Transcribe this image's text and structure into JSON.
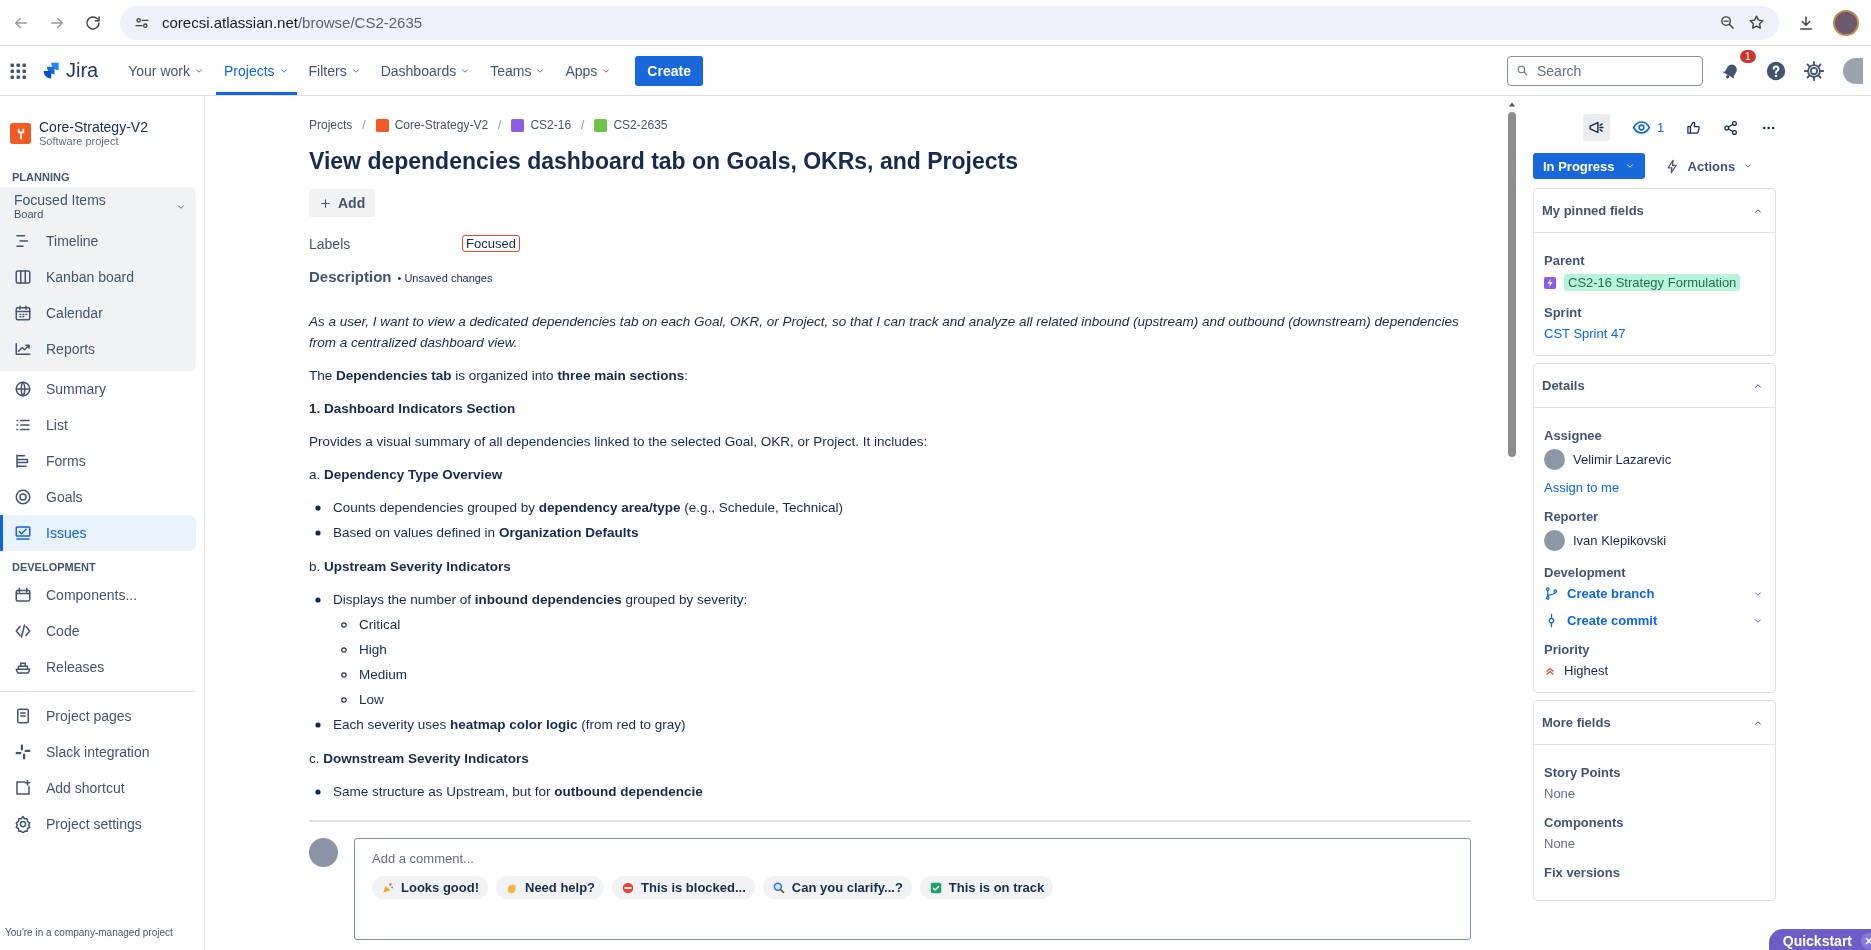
{
  "browser": {
    "url_host": "corecsi.atlassian.net",
    "url_path": "/browse/CS2-2635"
  },
  "nav": {
    "product": "Jira",
    "items": [
      {
        "label": "Your work",
        "selected": false
      },
      {
        "label": "Projects",
        "selected": true
      },
      {
        "label": "Filters",
        "selected": false
      },
      {
        "label": "Dashboards",
        "selected": false
      },
      {
        "label": "Teams",
        "selected": false
      },
      {
        "label": "Apps",
        "selected": false
      }
    ],
    "create": "Create",
    "search_placeholder": "Search",
    "notification_count": "1"
  },
  "sidebar": {
    "project": {
      "name": "Core-Strategy-V2",
      "type": "Software project"
    },
    "sections": [
      {
        "heading": "PLANNING",
        "group": {
          "title": "Focused Items",
          "subtitle": "Board",
          "expanded": true,
          "items": [
            {
              "label": "Timeline",
              "selected": false
            },
            {
              "label": "Kanban board",
              "selected": false
            },
            {
              "label": "Calendar",
              "selected": false
            },
            {
              "label": "Reports",
              "selected": false
            }
          ]
        },
        "items": [
          {
            "label": "Summary",
            "selected": false
          },
          {
            "label": "List",
            "selected": false
          },
          {
            "label": "Forms",
            "selected": false
          },
          {
            "label": "Goals",
            "selected": false
          },
          {
            "label": "Issues",
            "selected": true
          }
        ]
      },
      {
        "heading": "DEVELOPMENT",
        "items": [
          {
            "label": "Components...",
            "selected": false
          },
          {
            "label": "Code",
            "selected": false
          },
          {
            "label": "Releases",
            "selected": false
          }
        ]
      },
      {
        "items": [
          {
            "label": "Project pages",
            "selected": false
          },
          {
            "label": "Slack integration",
            "selected": false
          },
          {
            "label": "Add shortcut",
            "selected": false
          },
          {
            "label": "Project settings",
            "selected": false
          }
        ]
      }
    ],
    "footer": "You're in a company-managed project"
  },
  "issue": {
    "breadcrumbs": [
      "Projects",
      "Core-Strategy-V2",
      "CS2-16",
      "CS2-2635"
    ],
    "breadcrumb_separator": "/",
    "title": "View dependencies dashboard tab on Goals, OKRs, and Projects",
    "add_button": "Add",
    "labels": {
      "label": "Labels",
      "values": [
        "Focused"
      ]
    },
    "description": {
      "label": "Description",
      "note": "• Unsaved changes",
      "blocks": [
        {
          "kind": "intro",
          "text": "As a user, I want to view a dedicated dependencies tab on each Goal, OKR, or Project, so that I can track and analyze all related inbound (upstream) and outbound (downstream) dependencies from a centralized dashboard view."
        },
        {
          "kind": "paragraph",
          "text": "The **Dependencies tab** is organized into **three main sections**:"
        },
        {
          "kind": "heading",
          "text": "1. Dashboard Indicators Section"
        },
        {
          "kind": "paragraph",
          "text": "Provides a visual summary of all dependencies linked to the selected Goal, OKR, or Project. It includes:"
        },
        {
          "kind": "paragraph",
          "text": "a. **Dependency Type Overview**"
        },
        {
          "kind": "list",
          "items": [
            {
              "text": "Counts dependencies grouped by **dependency area/type** (e.g., Schedule, Technical)"
            },
            {
              "text": "Based on values defined in **Organization Defaults**"
            }
          ]
        },
        {
          "kind": "paragraph",
          "text": "b. **Upstream Severity Indicators**"
        },
        {
          "kind": "list",
          "items": [
            {
              "text": "Displays the number of **inbound dependencies** grouped by severity:",
              "children": [
                {
                  "text": "Critical"
                },
                {
                  "text": "High"
                },
                {
                  "text": "Medium"
                },
                {
                  "text": "Low"
                }
              ]
            },
            {
              "text": "Each severity uses **heatmap color logic** (from red to gray)"
            }
          ]
        },
        {
          "kind": "paragraph",
          "text": "c. **Downstream Severity Indicators**"
        },
        {
          "kind": "list",
          "items": [
            {
              "text": "Same structure as Upstream, but for **outbound dependencie**"
            }
          ]
        }
      ]
    },
    "comment": {
      "placeholder": "Add a comment...",
      "quick_replies": [
        "Looks good!",
        "Need help?",
        "This is blocked...",
        "Can you clarify...?",
        "This is on track"
      ]
    }
  },
  "panel": {
    "watch_count": "1",
    "status": "In Progress",
    "actions": "Actions",
    "cards": [
      {
        "title": "My pinned fields",
        "expanded": true,
        "fields": [
          {
            "kind": "parent",
            "label": "Parent",
            "value": "CS2-16 Strategy Formulation"
          },
          {
            "kind": "link",
            "label": "Sprint",
            "value": "CST Sprint 47"
          }
        ]
      },
      {
        "title": "Details",
        "expanded": true,
        "fields": [
          {
            "kind": "person",
            "label": "Assignee",
            "value": "Velimir Lazarevic",
            "action": "Assign to me"
          },
          {
            "kind": "person",
            "label": "Reporter",
            "value": "Ivan Klepikovski"
          },
          {
            "kind": "development",
            "label": "Development",
            "options": [
              "Create branch",
              "Create commit"
            ]
          },
          {
            "kind": "priority",
            "label": "Priority",
            "value": "Highest"
          }
        ]
      },
      {
        "title": "More fields",
        "expanded": true,
        "fields": [
          {
            "kind": "text",
            "label": "Story Points",
            "value": "None"
          },
          {
            "kind": "text",
            "label": "Components",
            "value": "None"
          },
          {
            "kind": "label-only",
            "label": "Fix versions"
          }
        ]
      }
    ],
    "quickstart": "Quickstart"
  }
}
